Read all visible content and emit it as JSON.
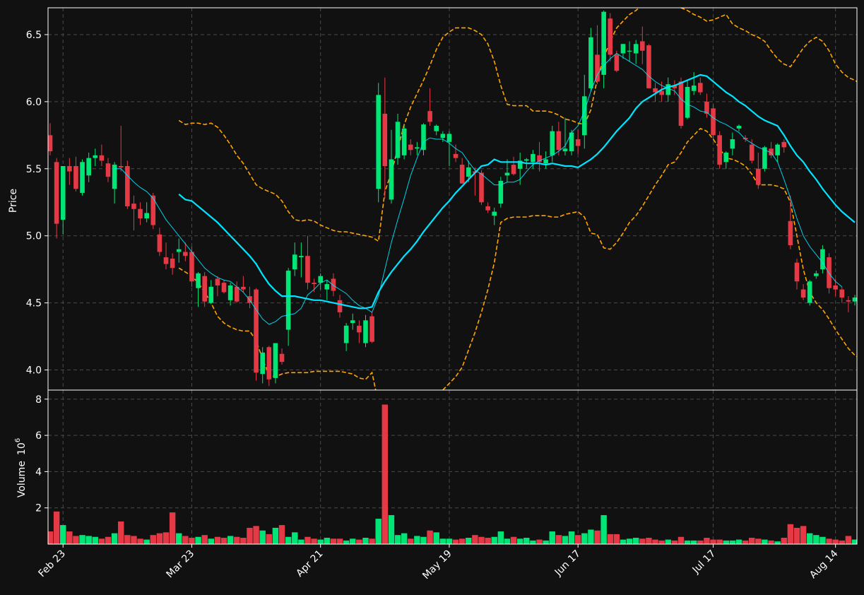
{
  "chart_data": {
    "type": "candlestick",
    "dates": [
      "02-21",
      "02-22",
      "02-23",
      "02-24",
      "02-27",
      "02-28",
      "03-01",
      "03-02",
      "03-03",
      "03-06",
      "03-07",
      "03-08",
      "03-09",
      "03-10",
      "03-13",
      "03-14",
      "03-15",
      "03-16",
      "03-17",
      "03-20",
      "03-21",
      "03-22",
      "03-23",
      "03-24",
      "03-27",
      "03-28",
      "03-29",
      "03-30",
      "03-31",
      "04-03",
      "04-04",
      "04-05",
      "04-06",
      "04-10",
      "04-11",
      "04-12",
      "04-13",
      "04-14",
      "04-17",
      "04-18",
      "04-19",
      "04-20",
      "04-21",
      "04-24",
      "04-25",
      "04-26",
      "04-27",
      "04-28",
      "05-01",
      "05-02",
      "05-03",
      "05-04",
      "05-05",
      "05-08",
      "05-09",
      "05-10",
      "05-11",
      "05-12",
      "05-15",
      "05-16",
      "05-17",
      "05-18",
      "05-19",
      "05-22",
      "05-23",
      "05-24",
      "05-25",
      "05-26",
      "05-29",
      "05-30",
      "05-31",
      "06-01",
      "06-02",
      "06-05",
      "06-06",
      "06-07",
      "06-08",
      "06-09",
      "06-12",
      "06-13",
      "06-14",
      "06-15",
      "06-16",
      "06-19",
      "06-20",
      "06-21",
      "06-22",
      "06-23",
      "06-26",
      "06-27",
      "06-28",
      "06-29",
      "06-30",
      "07-03",
      "07-04",
      "07-05",
      "07-06",
      "07-07",
      "07-10",
      "07-11",
      "07-12",
      "07-13",
      "07-14",
      "07-17",
      "07-18",
      "07-19",
      "07-20",
      "07-21",
      "07-24",
      "07-25",
      "07-26",
      "07-27",
      "07-28",
      "07-31",
      "08-01",
      "08-02",
      "08-03",
      "08-04",
      "08-07",
      "08-08",
      "08-09",
      "08-10",
      "08-11",
      "08-14",
      "08-15",
      "08-16",
      "08-17",
      "08-18"
    ],
    "candles": [
      [
        5.75,
        5.84,
        5.6,
        5.63
      ],
      [
        5.55,
        5.58,
        4.98,
        5.09
      ],
      [
        5.12,
        5.52,
        5.01,
        5.52
      ],
      [
        5.52,
        5.58,
        5.38,
        5.48
      ],
      [
        5.52,
        5.59,
        5.33,
        5.35
      ],
      [
        5.32,
        5.57,
        5.3,
        5.55
      ],
      [
        5.45,
        5.62,
        5.4,
        5.58
      ],
      [
        5.58,
        5.65,
        5.52,
        5.6
      ],
      [
        5.6,
        5.68,
        5.52,
        5.56
      ],
      [
        5.54,
        5.58,
        5.4,
        5.44
      ],
      [
        5.35,
        5.55,
        5.24,
        5.53
      ],
      [
        5.52,
        5.82,
        5.48,
        5.51
      ],
      [
        5.52,
        5.56,
        5.2,
        5.22
      ],
      [
        5.24,
        5.3,
        5.04,
        5.2
      ],
      [
        5.2,
        5.25,
        5.08,
        5.13
      ],
      [
        5.13,
        5.25,
        5.1,
        5.17
      ],
      [
        5.3,
        5.32,
        5.05,
        5.08
      ],
      [
        5.01,
        5.06,
        4.85,
        4.88
      ],
      [
        4.84,
        4.95,
        4.75,
        4.79
      ],
      [
        4.83,
        4.87,
        4.71,
        4.76
      ],
      [
        4.88,
        4.98,
        4.8,
        4.9
      ],
      [
        4.88,
        4.95,
        4.81,
        4.85
      ],
      [
        4.88,
        4.92,
        4.62,
        4.66
      ],
      [
        4.61,
        4.73,
        4.47,
        4.72
      ],
      [
        4.7,
        4.73,
        4.47,
        4.51
      ],
      [
        4.5,
        4.67,
        4.49,
        4.62
      ],
      [
        4.68,
        4.7,
        4.55,
        4.63
      ],
      [
        4.65,
        4.67,
        4.57,
        4.58
      ],
      [
        4.52,
        4.65,
        4.48,
        4.63
      ],
      [
        4.62,
        4.66,
        4.5,
        4.51
      ],
      [
        4.62,
        4.7,
        4.58,
        4.6
      ],
      [
        4.55,
        4.62,
        4.46,
        4.5
      ],
      [
        4.6,
        4.61,
        3.92,
        3.98
      ],
      [
        3.97,
        4.17,
        3.9,
        4.13
      ],
      [
        4.17,
        4.18,
        3.88,
        3.93
      ],
      [
        3.94,
        4.18,
        3.9,
        4.2
      ],
      [
        4.12,
        4.16,
        4.04,
        4.06
      ],
      [
        4.3,
        4.76,
        4.18,
        4.74
      ],
      [
        4.75,
        4.95,
        4.7,
        4.86
      ],
      [
        4.84,
        4.95,
        4.69,
        4.85
      ],
      [
        4.85,
        5.0,
        4.6,
        4.65
      ],
      [
        4.65,
        4.68,
        4.58,
        4.64
      ],
      [
        4.65,
        4.72,
        4.6,
        4.7
      ],
      [
        4.6,
        4.67,
        4.52,
        4.64
      ],
      [
        4.68,
        4.72,
        4.55,
        4.59
      ],
      [
        4.52,
        4.56,
        4.39,
        4.43
      ],
      [
        4.2,
        4.35,
        4.14,
        4.33
      ],
      [
        4.35,
        4.42,
        4.3,
        4.37
      ],
      [
        4.33,
        4.37,
        4.2,
        4.28
      ],
      [
        4.2,
        4.41,
        4.17,
        4.37
      ],
      [
        4.4,
        4.43,
        4.2,
        4.21
      ],
      [
        5.35,
        6.14,
        5.25,
        6.05
      ],
      [
        5.91,
        6.18,
        5.28,
        5.52
      ],
      [
        5.27,
        5.79,
        5.24,
        5.57
      ],
      [
        5.58,
        5.91,
        5.53,
        5.85
      ],
      [
        5.6,
        5.82,
        5.57,
        5.8
      ],
      [
        5.68,
        5.72,
        5.6,
        5.64
      ],
      [
        5.65,
        5.7,
        5.6,
        5.66
      ],
      [
        5.64,
        5.84,
        5.6,
        5.83
      ],
      [
        5.93,
        6.1,
        5.82,
        5.85
      ],
      [
        5.78,
        5.83,
        5.75,
        5.82
      ],
      [
        5.73,
        5.78,
        5.7,
        5.76
      ],
      [
        5.7,
        5.78,
        5.52,
        5.76
      ],
      [
        5.61,
        5.68,
        5.55,
        5.58
      ],
      [
        5.53,
        5.58,
        5.39,
        5.39
      ],
      [
        5.44,
        5.56,
        5.4,
        5.51
      ],
      [
        5.48,
        5.51,
        5.3,
        5.47
      ],
      [
        5.47,
        5.49,
        5.23,
        5.25
      ],
      [
        5.22,
        5.25,
        5.17,
        5.19
      ],
      [
        5.15,
        5.21,
        5.08,
        5.18
      ],
      [
        5.24,
        5.44,
        5.21,
        5.41
      ],
      [
        5.45,
        5.57,
        5.4,
        5.47
      ],
      [
        5.53,
        5.59,
        5.45,
        5.46
      ],
      [
        5.5,
        5.62,
        5.38,
        5.56
      ],
      [
        5.56,
        5.58,
        5.5,
        5.57
      ],
      [
        5.55,
        5.64,
        5.5,
        5.61
      ],
      [
        5.6,
        5.7,
        5.48,
        5.55
      ],
      [
        5.54,
        5.63,
        5.5,
        5.57
      ],
      [
        5.6,
        5.82,
        5.55,
        5.78
      ],
      [
        5.78,
        5.85,
        5.6,
        5.64
      ],
      [
        5.63,
        5.88,
        5.6,
        5.65
      ],
      [
        5.63,
        5.79,
        5.6,
        5.77
      ],
      [
        5.72,
        5.79,
        5.61,
        5.67
      ],
      [
        5.75,
        6.2,
        5.65,
        6.04
      ],
      [
        6.1,
        6.55,
        6.08,
        6.48
      ],
      [
        6.35,
        6.57,
        6.13,
        6.15
      ],
      [
        6.2,
        6.68,
        6.1,
        6.67
      ],
      [
        6.62,
        6.66,
        6.3,
        6.35
      ],
      [
        6.35,
        6.38,
        6.22,
        6.23
      ],
      [
        6.36,
        6.43,
        6.32,
        6.43
      ],
      [
        6.38,
        6.45,
        6.3,
        6.38
      ],
      [
        6.36,
        6.46,
        6.28,
        6.43
      ],
      [
        6.45,
        6.56,
        6.28,
        6.38
      ],
      [
        6.42,
        6.43,
        6.1,
        6.1
      ],
      [
        6.1,
        6.14,
        6.0,
        6.07
      ],
      [
        6.08,
        6.15,
        6.0,
        6.05
      ],
      [
        6.05,
        6.18,
        6.0,
        6.13
      ],
      [
        6.12,
        6.16,
        6.05,
        6.1
      ],
      [
        6.15,
        6.18,
        5.8,
        5.82
      ],
      [
        5.88,
        6.16,
        5.87,
        6.11
      ],
      [
        6.08,
        6.22,
        6.05,
        6.12
      ],
      [
        6.14,
        6.18,
        6.05,
        6.07
      ],
      [
        6.0,
        6.06,
        5.88,
        5.91
      ],
      [
        5.95,
        5.98,
        5.72,
        5.75
      ],
      [
        5.75,
        5.78,
        5.5,
        5.53
      ],
      [
        5.55,
        5.63,
        5.5,
        5.62
      ],
      [
        5.65,
        5.77,
        5.6,
        5.72
      ],
      [
        5.8,
        5.83,
        5.78,
        5.82
      ],
      [
        5.73,
        5.75,
        5.7,
        5.72
      ],
      [
        5.68,
        5.72,
        5.54,
        5.56
      ],
      [
        5.5,
        5.62,
        5.35,
        5.38
      ],
      [
        5.5,
        5.67,
        5.48,
        5.66
      ],
      [
        5.65,
        5.7,
        5.58,
        5.6
      ],
      [
        5.6,
        5.69,
        5.55,
        5.68
      ],
      [
        5.7,
        5.72,
        5.62,
        5.66
      ],
      [
        5.11,
        5.3,
        4.9,
        4.93
      ],
      [
        4.8,
        4.83,
        4.6,
        4.66
      ],
      [
        4.6,
        4.64,
        4.52,
        4.54
      ],
      [
        4.5,
        4.67,
        4.48,
        4.66
      ],
      [
        4.7,
        4.74,
        4.68,
        4.72
      ],
      [
        4.75,
        4.93,
        4.72,
        4.9
      ],
      [
        4.84,
        4.87,
        4.57,
        4.61
      ],
      [
        4.63,
        4.68,
        4.55,
        4.6
      ],
      [
        4.6,
        4.62,
        4.5,
        4.54
      ],
      [
        4.52,
        4.55,
        4.43,
        4.51
      ],
      [
        4.51,
        4.56,
        4.48,
        4.54
      ]
    ],
    "volume_millions": [
      0.7,
      1.8,
      1.05,
      0.7,
      0.45,
      0.5,
      0.45,
      0.4,
      0.3,
      0.4,
      0.6,
      1.25,
      0.5,
      0.45,
      0.3,
      0.25,
      0.5,
      0.6,
      0.65,
      1.75,
      0.6,
      0.45,
      0.35,
      0.4,
      0.5,
      0.3,
      0.4,
      0.35,
      0.45,
      0.4,
      0.35,
      0.9,
      1.0,
      0.75,
      0.55,
      0.9,
      1.05,
      0.4,
      0.65,
      0.25,
      0.4,
      0.3,
      0.25,
      0.35,
      0.3,
      0.3,
      0.2,
      0.3,
      0.25,
      0.35,
      0.3,
      1.4,
      7.7,
      1.6,
      0.5,
      0.6,
      0.3,
      0.45,
      0.4,
      0.75,
      0.65,
      0.3,
      0.3,
      0.25,
      0.3,
      0.35,
      0.5,
      0.4,
      0.35,
      0.4,
      0.7,
      0.3,
      0.4,
      0.3,
      0.35,
      0.2,
      0.25,
      0.2,
      0.7,
      0.5,
      0.45,
      0.7,
      0.5,
      0.6,
      0.8,
      0.75,
      1.6,
      0.55,
      0.55,
      0.25,
      0.3,
      0.35,
      0.3,
      0.35,
      0.25,
      0.2,
      0.25,
      0.2,
      0.4,
      0.2,
      0.2,
      0.2,
      0.35,
      0.25,
      0.25,
      0.2,
      0.2,
      0.25,
      0.2,
      0.35,
      0.3,
      0.25,
      0.2,
      0.15,
      0.35,
      1.1,
      0.9,
      1.0,
      0.6,
      0.5,
      0.4,
      0.3,
      0.25,
      0.2,
      0.45,
      0.25
    ],
    "sma_fast": [
      null,
      null,
      null,
      null,
      null,
      null,
      null,
      null,
      null,
      null,
      5.5,
      5.5,
      5.45,
      5.4,
      5.36,
      5.33,
      5.28,
      5.2,
      5.12,
      5.06,
      5.0,
      4.94,
      4.88,
      4.82,
      4.76,
      4.72,
      4.69,
      4.67,
      4.66,
      4.62,
      4.58,
      4.52,
      4.45,
      4.38,
      4.34,
      4.36,
      4.4,
      4.41,
      4.42,
      4.46,
      4.56,
      4.6,
      4.65,
      4.67,
      4.63,
      4.6,
      4.57,
      4.52,
      4.48,
      4.46,
      4.43,
      4.55,
      4.75,
      4.95,
      5.12,
      5.28,
      5.45,
      5.58,
      5.7,
      5.73,
      5.72,
      5.72,
      5.69,
      5.65,
      5.62,
      5.55,
      5.49,
      5.46,
      5.42,
      5.38,
      5.38,
      5.4,
      5.4,
      5.42,
      5.48,
      5.53,
      5.56,
      5.58,
      5.6,
      5.63,
      5.67,
      5.77,
      5.82,
      5.93,
      6.08,
      6.2,
      6.27,
      6.32,
      6.36,
      6.33,
      6.3,
      6.27,
      6.24,
      6.19,
      6.15,
      6.12,
      6.1,
      6.08,
      6.02,
      5.98,
      5.96,
      5.93,
      5.92,
      5.88,
      5.85,
      5.83,
      5.8,
      5.77,
      5.72,
      5.69,
      5.66,
      5.64,
      5.62,
      5.55,
      5.42,
      5.28,
      5.13,
      5.0,
      4.92,
      4.86,
      4.8,
      4.72,
      4.66,
      4.62
    ],
    "sma_slow": [
      null,
      null,
      null,
      null,
      null,
      null,
      null,
      null,
      null,
      null,
      null,
      null,
      null,
      null,
      null,
      null,
      null,
      null,
      null,
      null,
      5.31,
      5.27,
      5.26,
      5.22,
      5.18,
      5.14,
      5.1,
      5.05,
      5.0,
      4.95,
      4.9,
      4.85,
      4.79,
      4.71,
      4.64,
      4.59,
      4.55,
      4.55,
      4.55,
      4.54,
      4.53,
      4.52,
      4.52,
      4.51,
      4.5,
      4.49,
      4.48,
      4.47,
      4.46,
      4.46,
      4.47,
      4.58,
      4.66,
      4.73,
      4.79,
      4.85,
      4.9,
      4.96,
      5.03,
      5.09,
      5.15,
      5.21,
      5.26,
      5.32,
      5.37,
      5.42,
      5.47,
      5.52,
      5.53,
      5.57,
      5.55,
      5.55,
      5.55,
      5.55,
      5.54,
      5.54,
      5.54,
      5.53,
      5.54,
      5.53,
      5.52,
      5.52,
      5.51,
      5.54,
      5.57,
      5.61,
      5.66,
      5.72,
      5.78,
      5.83,
      5.88,
      5.95,
      6.0,
      6.03,
      6.06,
      6.09,
      6.11,
      6.12,
      6.14,
      6.16,
      6.18,
      6.2,
      6.19,
      6.15,
      6.11,
      6.07,
      6.04,
      6.0,
      5.97,
      5.93,
      5.89,
      5.86,
      5.84,
      5.82,
      5.75,
      5.67,
      5.6,
      5.55,
      5.48,
      5.42,
      5.35,
      5.29,
      5.23,
      5.18,
      5.14,
      5.1
    ],
    "bb_upper": [
      null,
      null,
      null,
      null,
      null,
      null,
      null,
      null,
      null,
      null,
      null,
      null,
      null,
      null,
      null,
      null,
      null,
      null,
      null,
      null,
      5.86,
      5.83,
      5.84,
      5.84,
      5.83,
      5.84,
      5.81,
      5.75,
      5.68,
      5.6,
      5.54,
      5.46,
      5.38,
      5.35,
      5.33,
      5.31,
      5.26,
      5.18,
      5.12,
      5.11,
      5.12,
      5.11,
      5.08,
      5.06,
      5.04,
      5.03,
      5.03,
      5.02,
      5.01,
      5.0,
      4.99,
      4.96,
      5.33,
      5.47,
      5.65,
      5.83,
      5.96,
      6.06,
      6.16,
      6.27,
      6.39,
      6.48,
      6.52,
      6.55,
      6.55,
      6.55,
      6.53,
      6.5,
      6.43,
      6.3,
      6.12,
      5.98,
      5.97,
      5.97,
      5.97,
      5.93,
      5.93,
      5.93,
      5.92,
      5.9,
      5.87,
      5.86,
      5.84,
      5.83,
      5.94,
      6.17,
      6.33,
      6.45,
      6.55,
      6.6,
      6.65,
      6.68,
      6.72,
      6.75,
      6.75,
      6.73,
      6.73,
      6.72,
      6.7,
      6.68,
      6.65,
      6.63,
      6.6,
      6.61,
      6.63,
      6.65,
      6.58,
      6.55,
      6.53,
      6.5,
      6.48,
      6.45,
      6.38,
      6.32,
      6.28,
      6.26,
      6.33,
      6.4,
      6.45,
      6.48,
      6.45,
      6.38,
      6.28,
      6.22,
      6.18,
      6.16,
      6.13
    ],
    "bb_lower": [
      null,
      null,
      null,
      null,
      null,
      null,
      null,
      null,
      null,
      null,
      null,
      null,
      null,
      null,
      null,
      null,
      null,
      null,
      null,
      null,
      4.76,
      4.73,
      4.7,
      4.65,
      4.58,
      4.5,
      4.4,
      4.35,
      4.32,
      4.3,
      4.29,
      4.29,
      4.22,
      4.08,
      3.96,
      3.95,
      3.97,
      3.98,
      3.98,
      3.98,
      3.98,
      3.99,
      3.99,
      3.99,
      3.99,
      3.99,
      3.98,
      3.97,
      3.94,
      3.93,
      3.98,
      3.75,
      3.55,
      3.35,
      3.15,
      3.0,
      2.95,
      3.05,
      3.4,
      3.65,
      3.75,
      3.85,
      3.9,
      3.95,
      4.02,
      4.15,
      4.28,
      4.43,
      4.6,
      4.8,
      5.1,
      5.13,
      5.14,
      5.14,
      5.14,
      5.15,
      5.15,
      5.15,
      5.14,
      5.14,
      5.16,
      5.17,
      5.18,
      5.14,
      5.02,
      5.01,
      4.91,
      4.9,
      4.95,
      5.02,
      5.1,
      5.15,
      5.22,
      5.3,
      5.38,
      5.45,
      5.53,
      5.55,
      5.62,
      5.7,
      5.75,
      5.8,
      5.78,
      5.72,
      5.65,
      5.58,
      5.57,
      5.55,
      5.52,
      5.46,
      5.38,
      5.38,
      5.38,
      5.37,
      5.35,
      5.25,
      5.0,
      4.75,
      4.58,
      4.5,
      4.45,
      4.38,
      4.3,
      4.23,
      4.16,
      4.11,
      4.08
    ],
    "x_ticks": [
      {
        "index": 2,
        "label": "Feb 23"
      },
      {
        "index": 22,
        "label": "Mar 23"
      },
      {
        "index": 42,
        "label": "Apr 21"
      },
      {
        "index": 62,
        "label": "May 19"
      },
      {
        "index": 82,
        "label": "Jun 17"
      },
      {
        "index": 103,
        "label": "Jul 17"
      },
      {
        "index": 122,
        "label": "Aug 14"
      }
    ],
    "price_ticks": [
      "4.0",
      "4.5",
      "5.0",
      "5.5",
      "6.0",
      "6.5"
    ],
    "price_tick_values": [
      4.0,
      4.5,
      5.0,
      5.5,
      6.0,
      6.5
    ],
    "price_ylim": [
      3.85,
      6.7
    ],
    "volume_ticks": [
      "2",
      "4",
      "6",
      "8"
    ],
    "volume_tick_values": [
      2,
      4,
      6,
      8
    ],
    "volume_ylim": [
      0,
      8.5
    ],
    "ylabel_price": "Price",
    "ylabel_volume": "Volume",
    "ylabel_volume_exponent": "10",
    "ylabel_volume_power": "6",
    "grid": true,
    "colors": {
      "up": "#00e676",
      "down": "#e63946",
      "sma": "#00e5ff",
      "bands": "#ffa500",
      "background": "#111111",
      "axes": "#ffffff",
      "grid": "#4a4a4a"
    }
  }
}
